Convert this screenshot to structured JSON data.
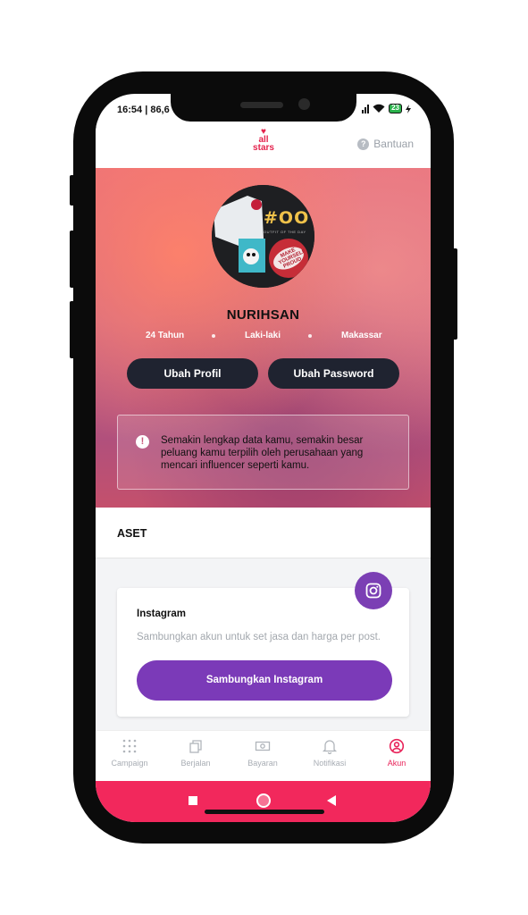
{
  "status_bar": {
    "time": "16:54 | 86,6",
    "battery": "23"
  },
  "header": {
    "logo_top": "all",
    "logo_bottom": "stars",
    "help_label": "Bantuan"
  },
  "profile": {
    "name": "NURIHSAN",
    "age": "24 Tahun",
    "gender": "Laki-laki",
    "city": "Makassar",
    "edit_profile_label": "Ubah Profil",
    "change_password_label": "Ubah Password",
    "notice": "Semakin lengkap data kamu, semakin besar peluang kamu terpilih oleh perusahaan yang mencari influencer seperti kamu.",
    "avatar_text": "#OOTD",
    "avatar_subtext": "OUTFIT OF THE DAY",
    "avatar_patch": "MAKE YOURSELF PROUD"
  },
  "assets": {
    "section_title": "ASET",
    "card_title": "Instagram",
    "card_description": "Sambungkan akun untuk set jasa dan harga per post.",
    "connect_label": "Sambungkan Instagram"
  },
  "nav": {
    "items": [
      {
        "label": "Campaign",
        "icon": "grid-icon"
      },
      {
        "label": "Berjalan",
        "icon": "copy-icon"
      },
      {
        "label": "Bayaran",
        "icon": "money-icon"
      },
      {
        "label": "Notifikasi",
        "icon": "bell-icon"
      },
      {
        "label": "Akun",
        "icon": "user-circle-icon"
      }
    ],
    "active_index": 4
  },
  "colors": {
    "accent": "#e8245a",
    "purple": "#7b3ab8",
    "dark_button": "#1f2330"
  }
}
